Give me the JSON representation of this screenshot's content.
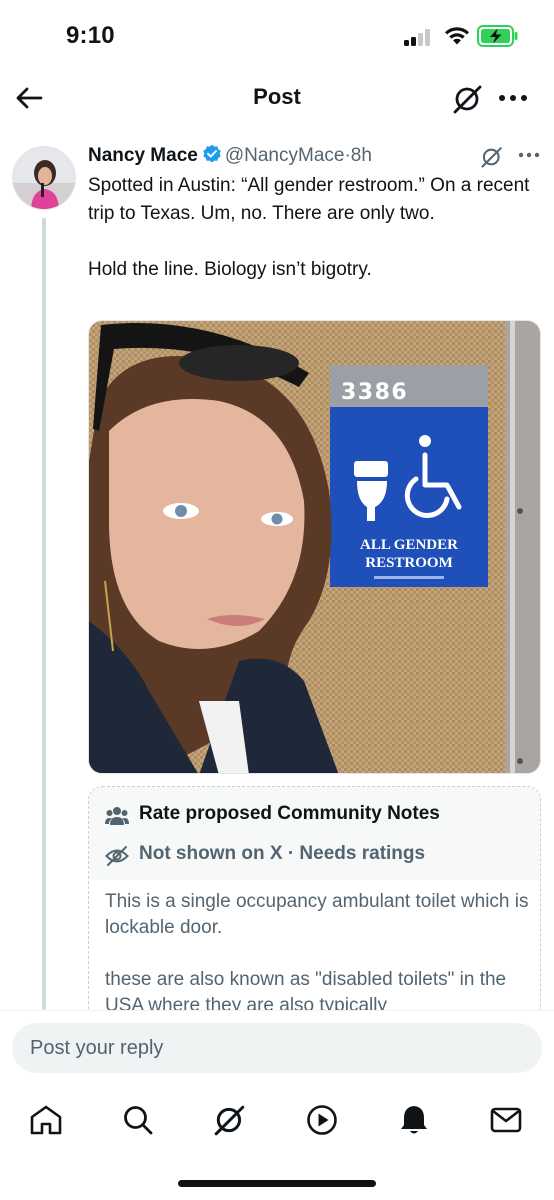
{
  "status_bar": {
    "time": "9:10",
    "icons": [
      "cellular-signal-icon",
      "wifi-icon",
      "battery-charging-icon"
    ],
    "battery_color": "#2fd158"
  },
  "header": {
    "title": "Post",
    "icons": [
      "back-arrow-icon",
      "grok-icon",
      "more-icon"
    ]
  },
  "post": {
    "author_name": "Nancy Mace",
    "handle": "@NancyMace",
    "separator": "·",
    "time": "8h",
    "verified_color": "#1d9bf0",
    "text": "Spotted in Austin: “All gender restroom.” On a recent trip to Texas. Um, no. There are only two.\n\nHold the line. Biology isn’t bigotry.",
    "image": {
      "sign_number": "3386",
      "sign_line1": "ALL GENDER",
      "sign_line2": "RESTROOM",
      "sign_color": "#1f4fb8"
    }
  },
  "community_note": {
    "title": "Rate proposed Community Notes",
    "status": "Not shown on X · Needs ratings",
    "body": "This is a single occupancy ambulant toilet which is lockable door.\n\nthese are also known as \"disabled toilets\" in the USA where they are also typically"
  },
  "reply": {
    "placeholder": "Post your reply"
  },
  "bottom_nav": {
    "items": [
      "home-icon",
      "search-icon",
      "grok-icon",
      "video-icon",
      "notifications-icon",
      "messages-icon"
    ]
  },
  "colors": {
    "text_primary": "#0f1419",
    "text_secondary": "#536471",
    "brand_blue": "#1d9bf0"
  }
}
